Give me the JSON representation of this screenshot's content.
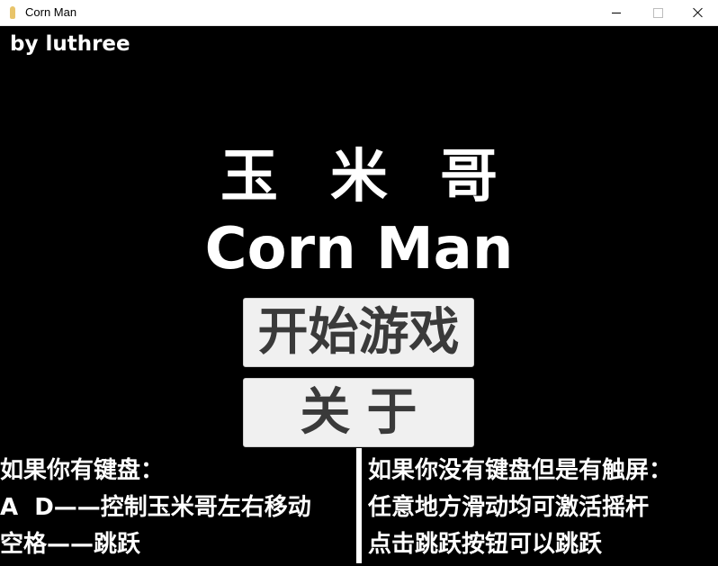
{
  "window": {
    "title": "Corn Man"
  },
  "game": {
    "credit": "by luthree",
    "title_cn": "玉米哥",
    "title_en": "Corn Man",
    "start_button": "开始游戏",
    "about_button": "关于",
    "help_keyboard": [
      "如果你有键盘：",
      "A  D——控制玉米哥左右移动",
      "空格——跳跃"
    ],
    "help_touch": [
      "如果你没有键盘但是有触屏：",
      "任意地方滑动均可激活摇杆",
      "点击跳跃按钮可以跳跃"
    ]
  },
  "colors": {
    "background": "#000000",
    "text": "#ffffff",
    "button_bg": "#f0f0f0",
    "button_text": "#3a3a3a"
  }
}
